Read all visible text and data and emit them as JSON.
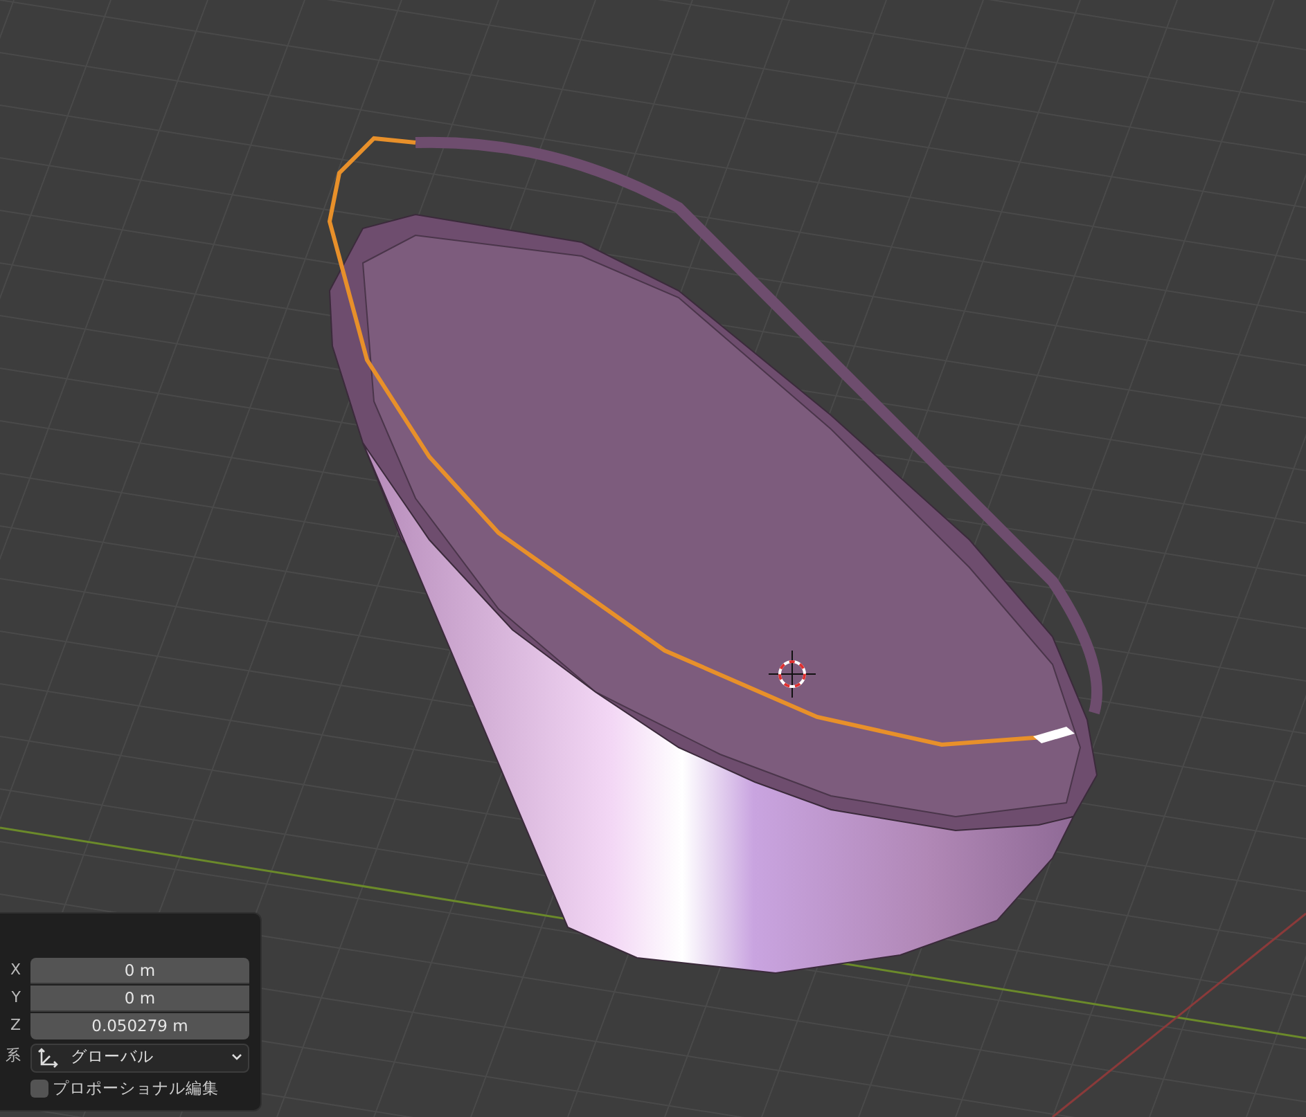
{
  "operator_panel": {
    "fields": [
      {
        "label": "X",
        "value": "0 m"
      },
      {
        "label": "Y",
        "value": "0 m"
      },
      {
        "label": "Z",
        "value": "0.050279 m"
      }
    ],
    "orientation": {
      "label": "系",
      "value": "グローバル"
    },
    "proportional_editing": {
      "label": "プロポーショナル編集",
      "checked": false
    }
  }
}
